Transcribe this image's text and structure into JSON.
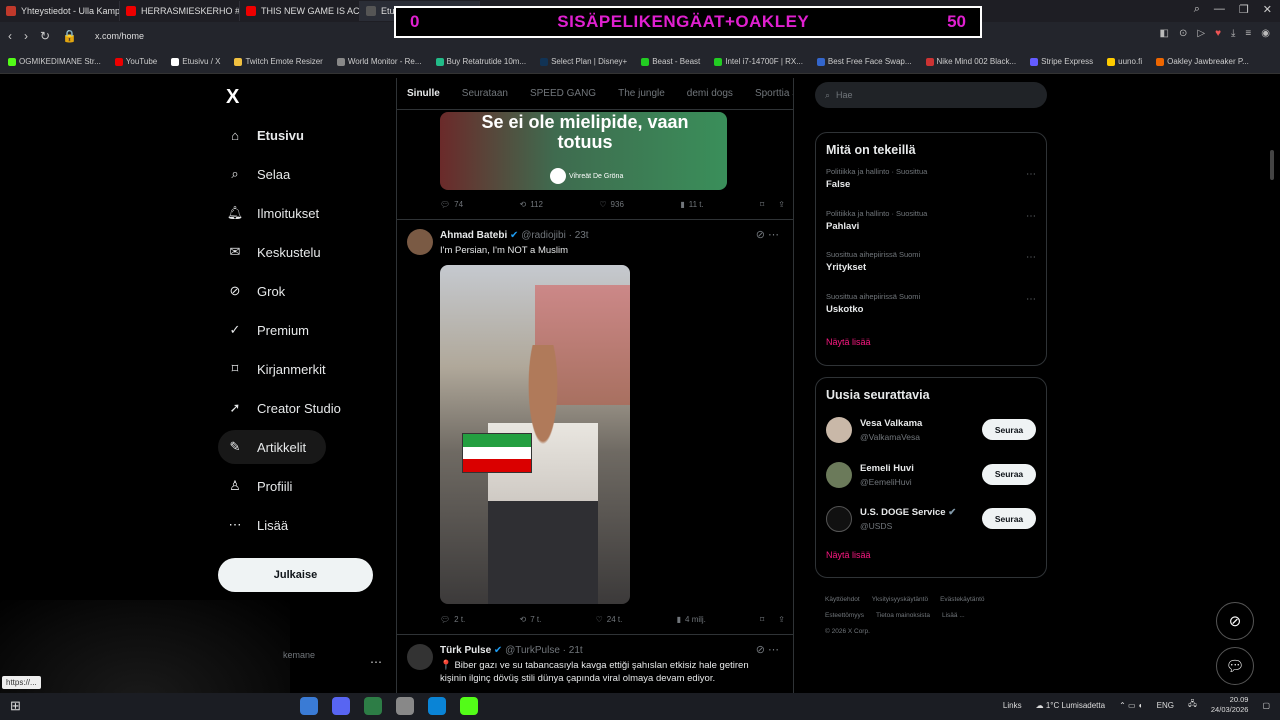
{
  "browser": {
    "tabs": [
      {
        "label": "Yhteystiedot - Ulla Kamp",
        "color": "#c0392b"
      },
      {
        "label": "HERRASMIESKERHO #15",
        "color": "#e00"
      },
      {
        "label": "THIS NEW GAME IS ACTU",
        "color": "#e00"
      },
      {
        "label": "Etusivu / X",
        "color": "#555"
      }
    ],
    "url": "x.com/home",
    "bookmarks": [
      {
        "label": "OGMIKEDIMANE Str...",
        "color": "#53fc18"
      },
      {
        "label": "YouTube",
        "color": "#e00"
      },
      {
        "label": "Etusivu / X",
        "color": "#fff"
      },
      {
        "label": "Twitch Emote Resizer",
        "color": "#f0c040"
      },
      {
        "label": "World Monitor - Re...",
        "color": "#888"
      },
      {
        "label": "Buy Retatrutide 10m...",
        "color": "#2b8"
      },
      {
        "label": "Select Plan | Disney+",
        "color": "#135"
      },
      {
        "label": "Beast - Beast",
        "color": "#2c2"
      },
      {
        "label": "Intel i7-14700F | RX...",
        "color": "#2c2"
      },
      {
        "label": "Best Free Face Swap...",
        "color": "#36c"
      },
      {
        "label": "Nike Mind 002 Black...",
        "color": "#c33"
      },
      {
        "label": "Stripe Express",
        "color": "#635bff"
      },
      {
        "label": "uuno.fi",
        "color": "#fc0"
      },
      {
        "label": "Oakley Jawbreaker P...",
        "color": "#e60"
      }
    ]
  },
  "overlay": {
    "left": "0",
    "title": "SISÄPELIKENGÄAT+OAKLEY",
    "right": "50"
  },
  "nav": {
    "logo": "X",
    "items": [
      {
        "label": "Etusivu",
        "icon": "home-icon"
      },
      {
        "label": "Selaa",
        "icon": "search-icon"
      },
      {
        "label": "Ilmoitukset",
        "icon": "bell-icon"
      },
      {
        "label": "Keskustelu",
        "icon": "mail-icon"
      },
      {
        "label": "Grok",
        "icon": "grok-icon"
      },
      {
        "label": "Premium",
        "icon": "verified-icon"
      },
      {
        "label": "Kirjanmerkit",
        "icon": "bookmark-icon"
      },
      {
        "label": "Creator Studio",
        "icon": "rocket-icon"
      },
      {
        "label": "Artikkelit",
        "icon": "article-icon"
      },
      {
        "label": "Profiili",
        "icon": "person-icon"
      },
      {
        "label": "Lisää",
        "icon": "more-icon"
      }
    ],
    "post_label": "Julkaise",
    "account_handle": "kemane",
    "status_link": "https://..."
  },
  "timeline": {
    "tabs": [
      "Sinulle",
      "Seurataan",
      "SPEED GANG",
      "The jungle",
      "demi dogs",
      "Sporttia Sa"
    ],
    "post1": {
      "image_text": "Se ei ole mielipide, vaan totuus",
      "brand": "Vihreät De Gröna",
      "replies": "74",
      "reposts": "112",
      "likes": "936",
      "views": "11 t."
    },
    "post2": {
      "name": "Ahmad Batebi",
      "handle": "@radiojibi · 23t",
      "text": "I'm Persian, I'm NOT a Muslim",
      "replies": "2 t.",
      "reposts": "7 t.",
      "likes": "24 t.",
      "views": "4 milj."
    },
    "post3": {
      "name": "Türk Pulse",
      "handle": "@TurkPulse · 21t",
      "text": "📍 Biber gazı ve su tabancasıyla kavga ettiği şahıslan etkisiz hale getiren kişinin ilginç dövüş stili dünya çapında viral olmaya devam ediyor."
    }
  },
  "right": {
    "search_placeholder": "Hae",
    "trends_title": "Mitä on tekeillä",
    "trends": [
      {
        "category": "Politiikka ja hallinto · Suosittua",
        "title": "False"
      },
      {
        "category": "Politiikka ja hallinto · Suosittua",
        "title": "Pahlavi"
      },
      {
        "category": "Suosittua aihepiirissä Suomi",
        "title": "Yritykset"
      },
      {
        "category": "Suosittua aihepiirissä Suomi",
        "title": "Uskotko"
      }
    ],
    "show_more": "Näytä lisää",
    "who_title": "Uusia seurattavia",
    "who": [
      {
        "name": "Vesa Valkama",
        "handle": "@ValkamaVesa"
      },
      {
        "name": "Eemeli Huvi",
        "handle": "@EemeliHuvi"
      },
      {
        "name": "U.S. DOGE Service",
        "handle": "@USDS"
      }
    ],
    "follow_label": "Seuraa",
    "footer": [
      "Käyttöehdot",
      "Yksityisyyskäytäntö",
      "Evästekäytäntö",
      "Esteettömyys",
      "Tietoa mainoksista",
      "Lisää ...",
      "© 2026 X Corp."
    ]
  },
  "taskbar": {
    "links": "Links",
    "weather": "1°C  Lumisadetta",
    "lang": "ENG",
    "time": "20.09",
    "date": "24/03/2026"
  }
}
